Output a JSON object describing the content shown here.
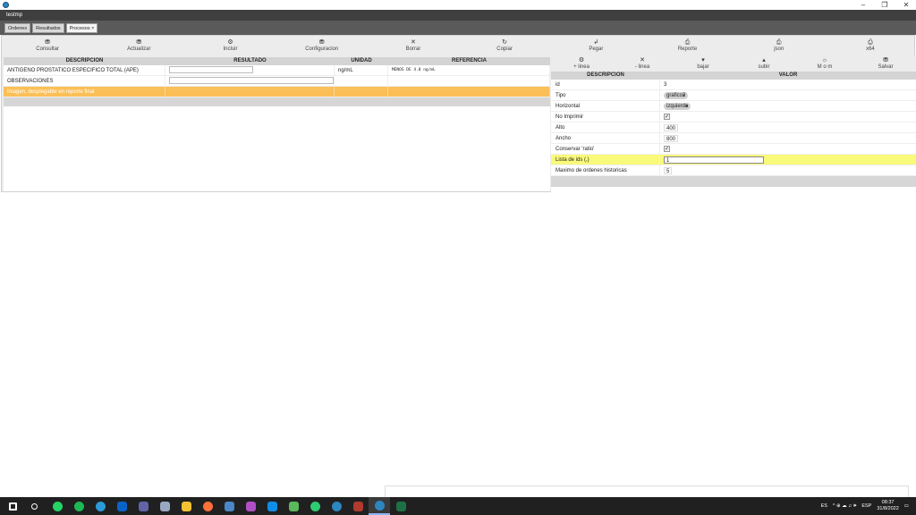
{
  "window": {
    "title": "testmp"
  },
  "window_controls": [
    "–",
    "❐",
    "✕"
  ],
  "tabs": [
    {
      "label": "Ordenes",
      "active": false
    },
    {
      "label": "Resultados",
      "active": false
    },
    {
      "label": "Procesos ×",
      "active": true
    }
  ],
  "toolbar": [
    {
      "label": "Consultar",
      "icon": "search-icon",
      "glyph": "⛃"
    },
    {
      "label": "Actualizar",
      "icon": "refresh-icon",
      "glyph": "⛃"
    },
    {
      "label": "Incluir",
      "icon": "add-icon",
      "glyph": "⚙"
    },
    {
      "label": "Configuracion",
      "icon": "config-icon",
      "glyph": "⛃"
    },
    {
      "label": "Borrar",
      "icon": "delete-icon",
      "glyph": "✕"
    },
    {
      "label": "Copiar",
      "icon": "copy-icon",
      "glyph": "↻"
    },
    {
      "label": "Pegar",
      "icon": "paste-icon",
      "glyph": "↲"
    },
    {
      "label": "Reporte",
      "icon": "print-icon",
      "glyph": "⎙"
    },
    {
      "label": "json",
      "icon": "print-icon",
      "glyph": "⎙"
    },
    {
      "label": "x64",
      "icon": "print-icon",
      "glyph": "⎙"
    }
  ],
  "left_grid": {
    "headers": {
      "descripcion": "DESCRIPCION",
      "resultado": "RESULTADO",
      "unidad": "UNIDAD",
      "referencia": "REFERENCIA"
    },
    "rows": [
      {
        "descripcion": "ANTIGENO PROSTATICO ESPECIFICO TOTAL (APE)",
        "resultado": "",
        "unidad": "ng/mL",
        "referencia": "MENOS DE 4.0 ng/mL"
      },
      {
        "descripcion": "OBSERVACIONES",
        "resultado": "",
        "unidad": "",
        "referencia": ""
      },
      {
        "descripcion": "Imagen, desplegable en reporte final",
        "resultado": "",
        "unidad": "",
        "referencia": ""
      }
    ]
  },
  "right_toolbar": [
    {
      "label": "+ linea",
      "icon": "add-line-icon",
      "glyph": "⚙"
    },
    {
      "label": "- linea",
      "icon": "remove-line-icon",
      "glyph": "✕"
    },
    {
      "label": "bajar",
      "icon": "arrow-down-icon",
      "glyph": "▾"
    },
    {
      "label": "subir",
      "icon": "arrow-up-icon",
      "glyph": "▴"
    },
    {
      "label": "M o m",
      "icon": "star-icon",
      "glyph": "☼"
    },
    {
      "label": "Salvar",
      "icon": "save-icon",
      "glyph": "⛃"
    }
  ],
  "properties": {
    "headers": {
      "descripcion": "DESCRIPCION",
      "valor": "VALOR"
    },
    "rows": [
      {
        "name": "id",
        "type": "text",
        "value": "3"
      },
      {
        "name": "Tipo",
        "type": "select",
        "value": "grafico2"
      },
      {
        "name": "Horizontal",
        "type": "select",
        "value": "izquierda"
      },
      {
        "name": "No Imprimir",
        "type": "checkbox",
        "value": "✓"
      },
      {
        "name": "Alto",
        "type": "box",
        "value": "400"
      },
      {
        "name": "Ancho",
        "type": "box",
        "value": "800"
      },
      {
        "name": "Conservar 'ratio'",
        "type": "checkbox",
        "value": "✓"
      },
      {
        "name": "Lista de ids (,)",
        "type": "input",
        "value": "1"
      },
      {
        "name": "Maximo de ordenes historicas",
        "type": "box",
        "value": "5"
      }
    ]
  },
  "taskbar": {
    "apps": [
      {
        "name": "windows-start-icon",
        "color": "#ffffff"
      },
      {
        "name": "search-icon",
        "color": "#ffffff"
      },
      {
        "name": "whatsapp-icon",
        "color": "#25d366"
      },
      {
        "name": "spotify-icon",
        "color": "#1db954"
      },
      {
        "name": "edge-icon",
        "color": "#2d9ad9"
      },
      {
        "name": "outlook-icon",
        "color": "#0a64c8"
      },
      {
        "name": "teams-icon",
        "color": "#6264a7"
      },
      {
        "name": "network-icon",
        "color": "#9aa9c2"
      },
      {
        "name": "file-explorer-icon",
        "color": "#f1c232"
      },
      {
        "name": "firefox-icon",
        "color": "#ff7139"
      },
      {
        "name": "virtualbox-icon",
        "color": "#4a86c8"
      },
      {
        "name": "app-icon",
        "color": "#b14fc5"
      },
      {
        "name": "teamviewer-icon",
        "color": "#0e8ee9"
      },
      {
        "name": "notepad-icon",
        "color": "#5cb85c"
      },
      {
        "name": "app-hs-icon",
        "color": "#2ecc71"
      },
      {
        "name": "app-browser-icon",
        "color": "#2e86c1"
      },
      {
        "name": "winrar-icon",
        "color": "#b03a2e"
      },
      {
        "name": "testmp-icon",
        "color": "#2e86c1",
        "active": true
      },
      {
        "name": "excel-icon",
        "color": "#1e7145"
      }
    ],
    "tray": {
      "lang": "ES",
      "icons": "^ ⊕ ☁ ♫ 🕪",
      "keyboard": "ESP",
      "time": "08:37",
      "date": "31/8/2022"
    }
  }
}
